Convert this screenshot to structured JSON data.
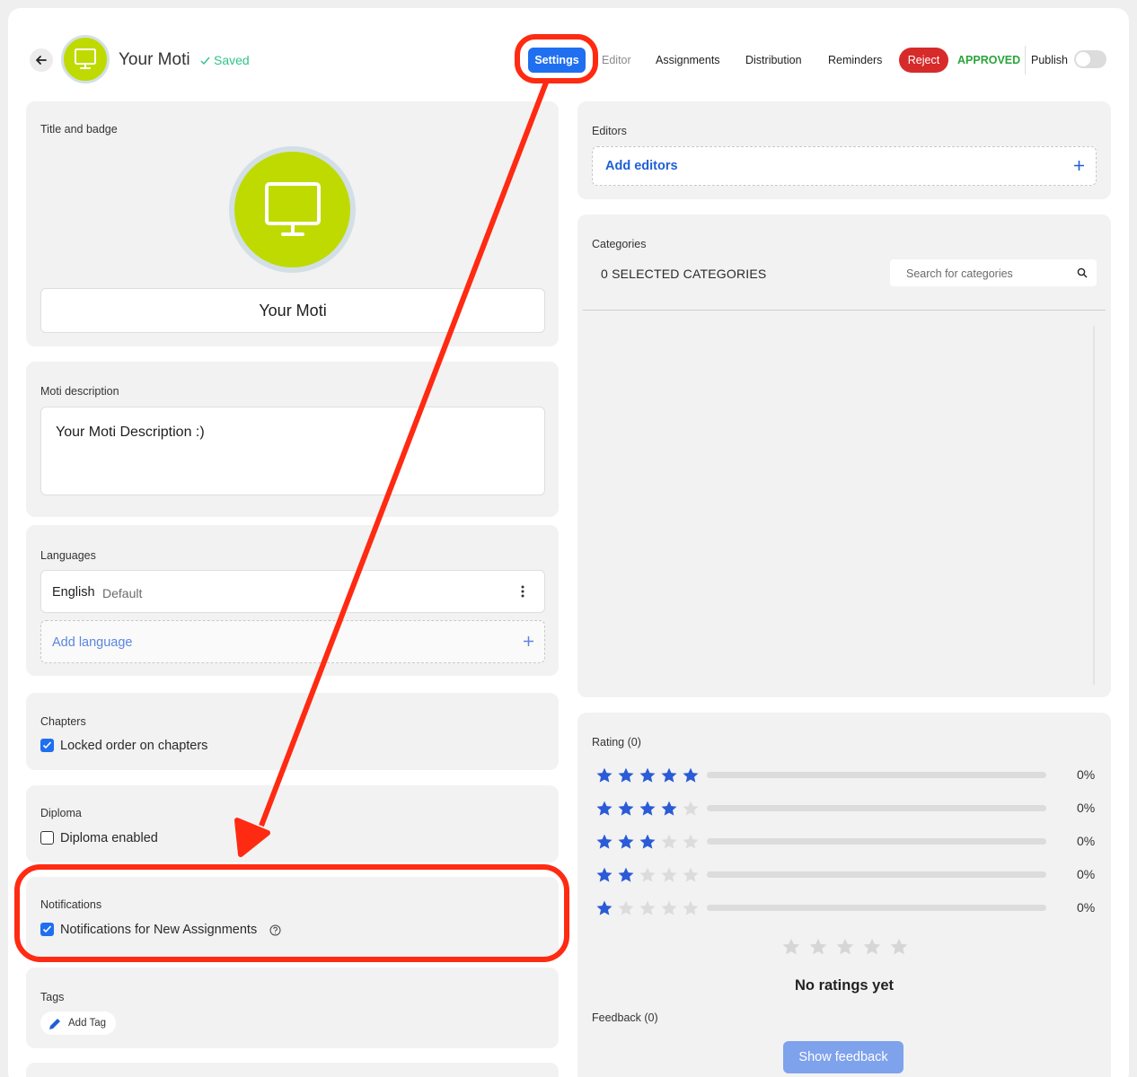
{
  "header": {
    "title": "Your Moti",
    "saved_label": "Saved",
    "nav": {
      "settings": "Settings",
      "editor": "Editor",
      "assignments": "Assignments",
      "distribution": "Distribution",
      "reminders": "Reminders",
      "reject": "Reject",
      "approved": "APPROVED",
      "publish": "Publish"
    },
    "publish_on": false
  },
  "title_badge": {
    "label": "Title and badge",
    "title_value": "Your Moti",
    "badge_color": "#bfda00"
  },
  "description": {
    "label": "Moti description",
    "value": "Your Moti Description :)"
  },
  "languages": {
    "label": "Languages",
    "items": [
      {
        "name": "English",
        "note": "Default"
      }
    ],
    "add_label": "Add language"
  },
  "chapters": {
    "label": "Chapters",
    "option": "Locked order on chapters",
    "checked": true
  },
  "diploma": {
    "label": "Diploma",
    "option": "Diploma enabled",
    "checked": false
  },
  "notifications": {
    "label": "Notifications",
    "option": "Notifications for New Assignments",
    "checked": true
  },
  "tags": {
    "label": "Tags",
    "add_label": "Add Tag"
  },
  "editors": {
    "label": "Editors",
    "add_label": "Add editors"
  },
  "categories": {
    "label": "Categories",
    "selected_text": "0 SELECTED CATEGORIES",
    "search_placeholder": "Search for categories"
  },
  "rating": {
    "label": "Rating (0)",
    "rows": [
      {
        "stars": 5,
        "percent": "0%"
      },
      {
        "stars": 4,
        "percent": "0%"
      },
      {
        "stars": 3,
        "percent": "0%"
      },
      {
        "stars": 2,
        "percent": "0%"
      },
      {
        "stars": 1,
        "percent": "0%"
      }
    ],
    "empty_text": "No ratings yet",
    "feedback_label": "Feedback (0)",
    "show_feedback": "Show feedback"
  },
  "colors": {
    "accent": "#1f6ff0",
    "reject": "#d72a2a",
    "approved": "#2aa53a",
    "saved": "#2fc48a",
    "annotation": "#ff2a12",
    "star": "#2b5bd6"
  }
}
